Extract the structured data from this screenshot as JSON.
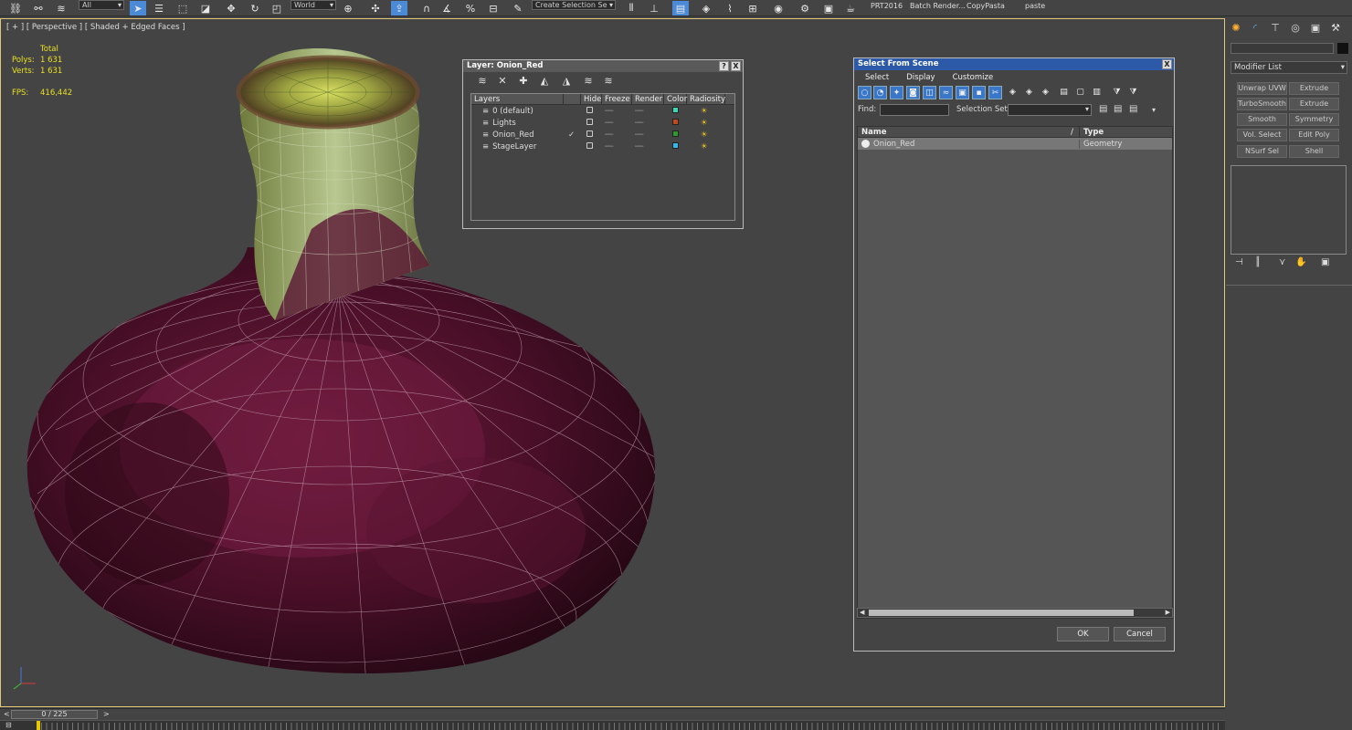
{
  "toolbar": {
    "filter_dropdown": "All",
    "coord_dropdown": "World",
    "named_selection_placeholder": "Create Selection Se",
    "scripts": [
      "PRT2016",
      "Batch Render...",
      "CopyPasta",
      "paste"
    ]
  },
  "viewport": {
    "label": "[ + ] [ Perspective ] [ Shaded + Edged Faces ]",
    "stats_total": "Total",
    "polys_label": "Polys:",
    "polys_value": "1 631",
    "verts_label": "Verts:",
    "verts_value": "1 631",
    "fps_label": "FPS:",
    "fps_value": "416,442"
  },
  "layer_dialog": {
    "title": "Layer: Onion_Red",
    "help_btn": "?",
    "close_btn": "X",
    "columns": [
      "Layers",
      "",
      "Hide",
      "Freeze",
      "Render",
      "Color",
      "Radiosity"
    ],
    "rows": [
      {
        "name": "0 (default)",
        "current": false,
        "color": "#3fd6b4"
      },
      {
        "name": "Lights",
        "current": false,
        "color": "#c04a20"
      },
      {
        "name": "Onion_Red",
        "current": true,
        "color": "#2e9a2e"
      },
      {
        "name": "StageLayer",
        "current": false,
        "color": "#35b8e8"
      }
    ]
  },
  "select_scene": {
    "title": "Select From Scene",
    "close_btn": "X",
    "menus": [
      "Select",
      "Display",
      "Customize"
    ],
    "find_label": "Find:",
    "find_value": "",
    "selection_set_label": "Selection Set:",
    "selection_set_value": "",
    "col_name": "Name",
    "col_sort": "/",
    "col_type": "Type",
    "items": [
      {
        "name": "Onion_Red",
        "type": "Geometry"
      }
    ],
    "ok_label": "OK",
    "cancel_label": "Cancel"
  },
  "command_panel": {
    "modifier_list": "Modifier List",
    "buttons": [
      "Unwrap UVW",
      "Extrude",
      "TurboSmooth",
      "Extrude",
      "Smooth",
      "Symmetry",
      "Vol. Select",
      "Edit Poly",
      "NSurf Sel",
      "Shell"
    ]
  },
  "timeline": {
    "frame_label": "0 / 225",
    "prev": "<",
    "next": ">"
  },
  "colors": {
    "accent_blue": "#2d5aa8",
    "stats_yellow": "#e8e020",
    "viewport_border": "#e0c878"
  }
}
